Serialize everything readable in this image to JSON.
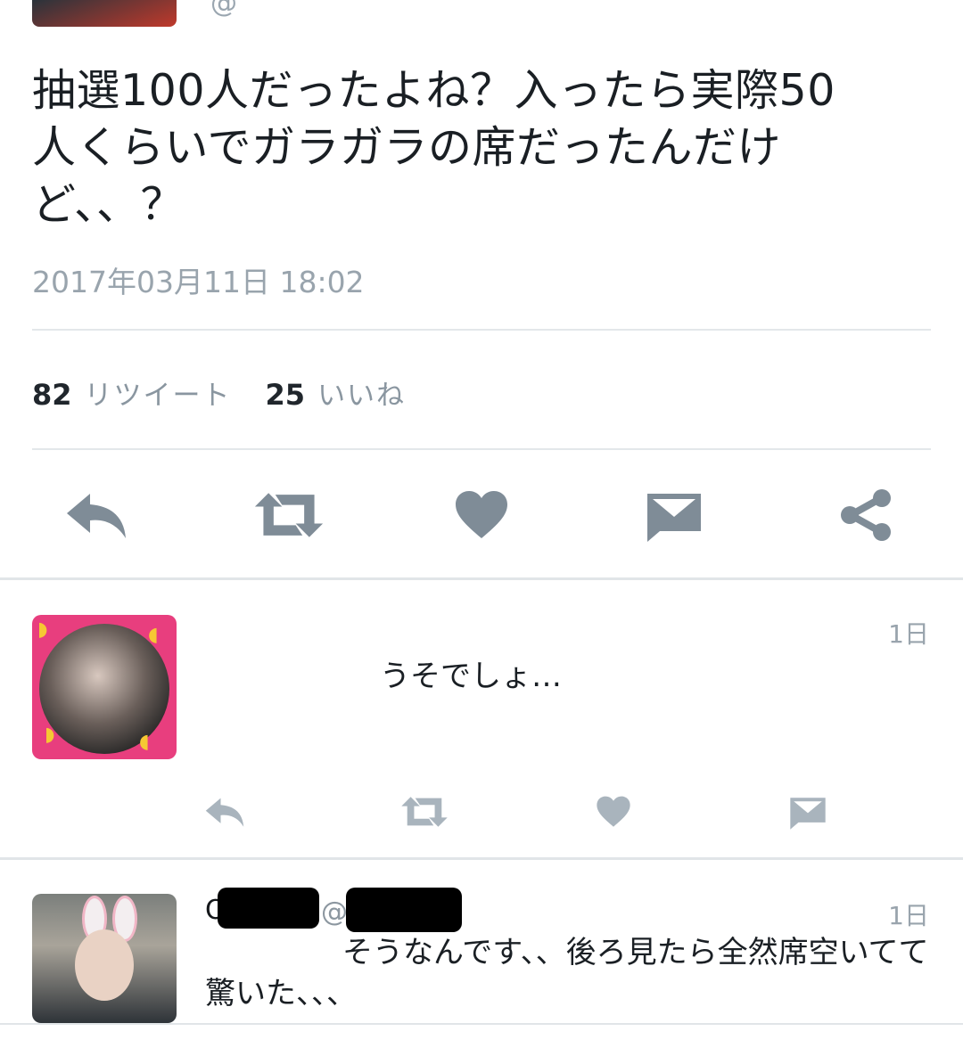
{
  "tweet": {
    "text_lines": [
      "抽選100人だったよね？入ったら実際50",
      "人くらいでガラガラの席だったんだけ",
      "ど、、？"
    ],
    "timestamp": "2017年03月11日 18:02",
    "retweet_count": "82",
    "retweet_label": "リツイート",
    "like_count": "25",
    "like_label": "いいね"
  },
  "actions": [
    "reply-icon",
    "retweet-icon",
    "heart-icon",
    "message-icon",
    "share-icon"
  ],
  "replies": [
    {
      "time": "1日",
      "text": "うそでしょ…",
      "actions": [
        "reply-icon",
        "retweet-icon",
        "heart-icon",
        "message-icon"
      ]
    },
    {
      "name_initial": "O",
      "at": "@",
      "time": "1日",
      "text_line1": "そうなんです、、後ろ見たら全然席空いてて",
      "text_line2": "驚いた、、、"
    }
  ],
  "colors": {
    "icon": "#7f8c97",
    "icon_light": "#a9b4bd",
    "meta_text": "#99a4ad",
    "avatar_pink": "#e83e7e"
  }
}
